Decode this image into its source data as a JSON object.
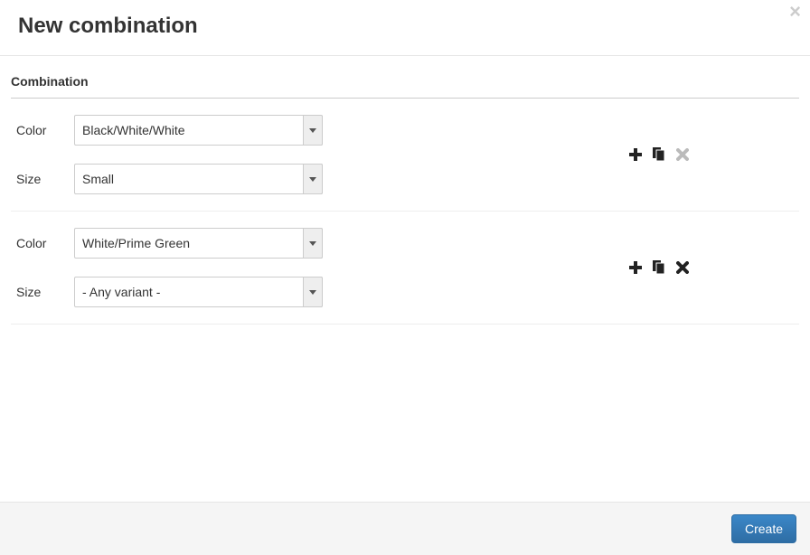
{
  "header": {
    "title": "New combination"
  },
  "section": {
    "title": "Combination"
  },
  "labels": {
    "color": "Color",
    "size": "Size"
  },
  "groups": [
    {
      "color": "Black/White/White",
      "size": "Small",
      "removeDisabled": true
    },
    {
      "color": "White/Prime Green",
      "size": "- Any variant -",
      "removeDisabled": false
    }
  ],
  "footer": {
    "createLabel": "Create"
  }
}
